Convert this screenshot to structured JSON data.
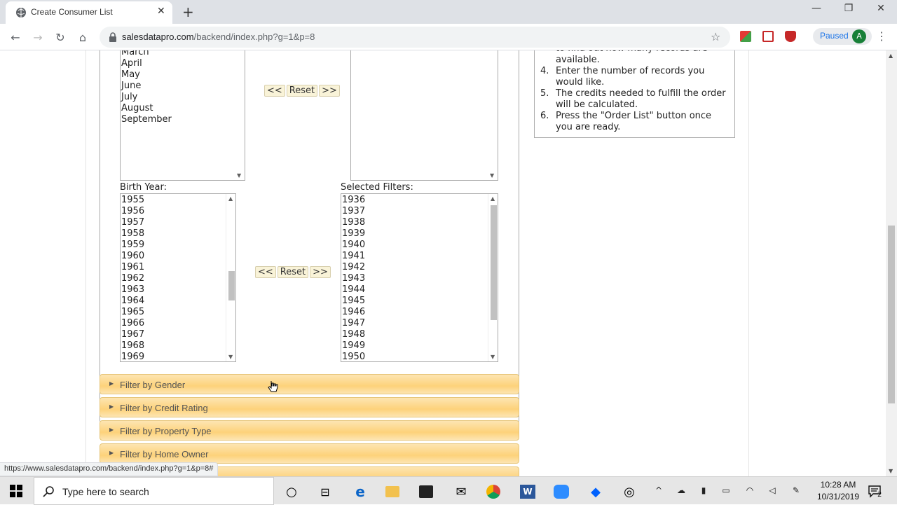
{
  "browser": {
    "tab_title": "Create Consumer List",
    "url_host": "salesdatapro.com",
    "url_path": "/backend/index.php?g=1&p=8",
    "profile_status": "Paused",
    "profile_initial": "A",
    "status_url": "https://www.salesdatapro.com/backend/index.php?g=1&p=8#"
  },
  "month_filter": {
    "available_options": [
      "March",
      "April",
      "May",
      "June",
      "July",
      "August",
      "September"
    ],
    "buttons": {
      "remove": "<<",
      "reset": "Reset",
      "add": ">>"
    }
  },
  "birth_year_filter": {
    "label": "Birth Year:",
    "available_options": [
      "1955",
      "1956",
      "1957",
      "1958",
      "1959",
      "1960",
      "1961",
      "1962",
      "1963",
      "1964",
      "1965",
      "1966",
      "1967",
      "1968",
      "1969"
    ],
    "selected_label": "Selected Filters:",
    "selected_options": [
      "1936",
      "1937",
      "1938",
      "1939",
      "1940",
      "1941",
      "1942",
      "1943",
      "1944",
      "1945",
      "1946",
      "1947",
      "1948",
      "1949",
      "1950"
    ],
    "buttons": {
      "remove": "<<",
      "reset": "Reset",
      "add": ">>"
    }
  },
  "accordions": [
    {
      "label": "Filter by Gender"
    },
    {
      "label": "Filter by Credit Rating"
    },
    {
      "label": "Filter by Property Type"
    },
    {
      "label": "Filter by Home Owner"
    }
  ],
  "instructions": {
    "steps": [
      {
        "num": "",
        "text": "to find out how many records are"
      },
      {
        "num": "",
        "text": "available."
      },
      {
        "num": "4.",
        "text": "Enter the number of records you"
      },
      {
        "num": "",
        "text": "would like."
      },
      {
        "num": "5.",
        "text": "The credits needed to fulfill the order"
      },
      {
        "num": "",
        "text": "will be calculated."
      },
      {
        "num": "6.",
        "text": "Press the \"Order List\" button once"
      },
      {
        "num": "",
        "text": "you are ready."
      }
    ]
  },
  "taskbar": {
    "search_placeholder": "Type here to search",
    "time": "10:28 AM",
    "date": "10/31/2019",
    "notification_count": "2"
  }
}
